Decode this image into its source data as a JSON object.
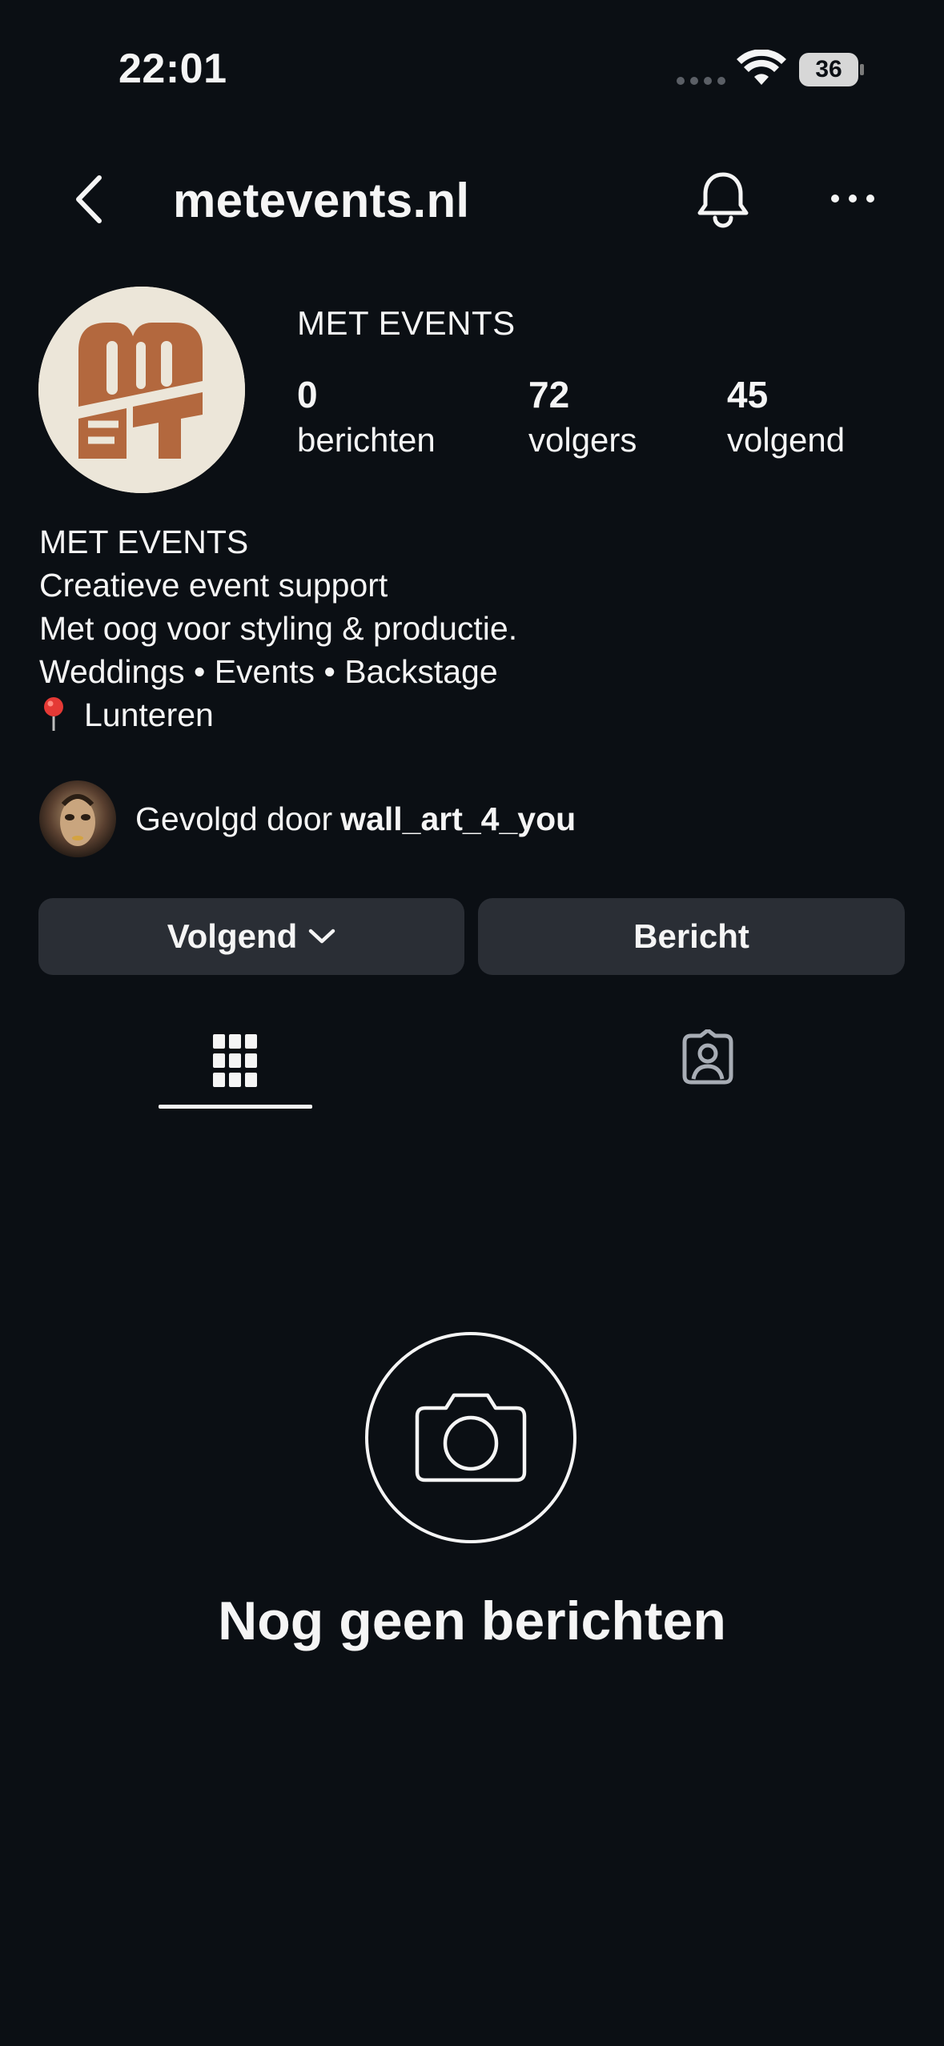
{
  "status_bar": {
    "time": "22:01",
    "battery": "36",
    "icons": [
      "signal-dots-icon",
      "wifi-icon",
      "battery-icon"
    ]
  },
  "header": {
    "username": "metevents.nl",
    "icons": [
      "back-chevron-icon",
      "bell-icon",
      "more-dots-icon"
    ]
  },
  "profile": {
    "display_name": "MET EVENTS",
    "avatar_icon": "met-events-logo",
    "stats": [
      {
        "count": "0",
        "label": "berichten"
      },
      {
        "count": "72",
        "label": "volgers"
      },
      {
        "count": "45",
        "label": "volgend"
      }
    ],
    "bio": [
      "MET EVENTS",
      "Creatieve event support",
      "Met oog voor styling & productie.",
      "Weddings • Events • Backstage"
    ],
    "location": "Lunteren",
    "location_icon": "pin-icon",
    "followed_by_prefix": "Gevolgd door",
    "followed_by_name": "wall_art_4_you"
  },
  "actions": {
    "following_label": "Volgend",
    "message_label": "Bericht"
  },
  "tabs": {
    "icons": [
      "grid-icon",
      "tagged-icon"
    ],
    "active": "grid"
  },
  "empty_state": {
    "icon": "camera-icon",
    "title": "Nog geen berichten"
  },
  "colors": {
    "background": "#0b0f14",
    "button": "#2a2e35",
    "text": "#f5f5f5",
    "logo_brown": "#b3683e",
    "logo_bg": "#ece6d9"
  }
}
